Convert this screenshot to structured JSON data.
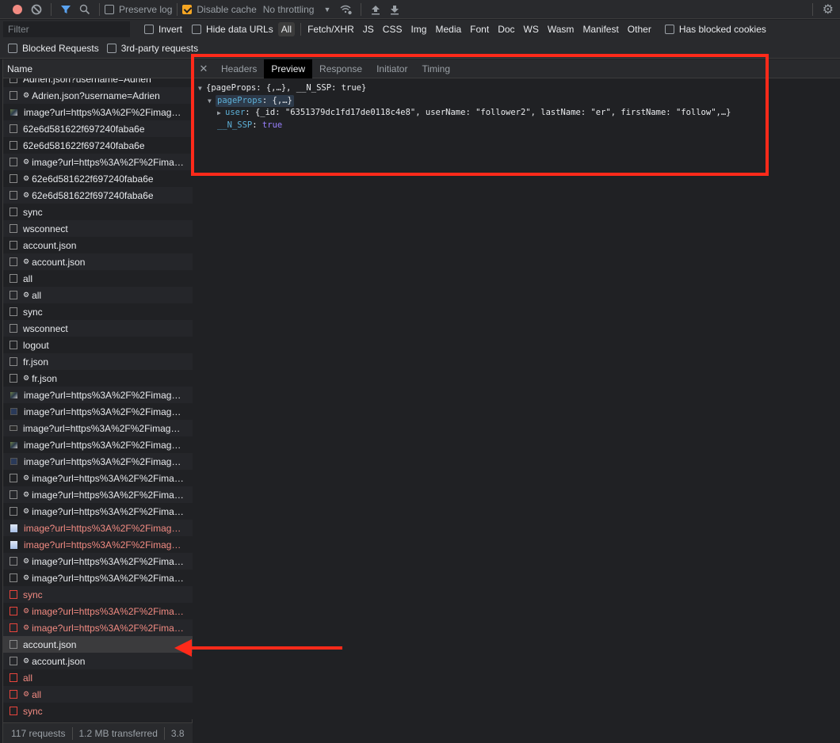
{
  "toolbar": {
    "record_icon": "record-icon",
    "clear_icon": "clear-icon",
    "filter_icon": "filter-icon",
    "search_icon": "search-icon",
    "preserve_log_label": "Preserve log",
    "preserve_log_checked": false,
    "disable_cache_label": "Disable cache",
    "disable_cache_checked": true,
    "throttling_value": "No throttling",
    "network_conditions_icon": "wifi-settings-icon",
    "import_icon": "upload-icon",
    "export_icon": "download-icon",
    "settings_icon": "gear-icon"
  },
  "filter": {
    "placeholder": "Filter",
    "value": "",
    "invert_label": "Invert",
    "hide_data_urls_label": "Hide data URLs",
    "types": [
      "All",
      "Fetch/XHR",
      "JS",
      "CSS",
      "Img",
      "Media",
      "Font",
      "Doc",
      "WS",
      "Wasm",
      "Manifest",
      "Other"
    ],
    "active_type": "All",
    "has_blocked_cookies_label": "Has blocked cookies",
    "blocked_requests_label": "Blocked Requests",
    "third_party_label": "3rd-party requests"
  },
  "requests": {
    "column_header": "Name",
    "items": [
      {
        "name": "Adrien.json?username=Adrien",
        "icon": "doc",
        "gear": false,
        "error": false
      },
      {
        "name": "Adrien.json?username=Adrien",
        "icon": "doc",
        "gear": true,
        "error": false
      },
      {
        "name": "image?url=https%3A%2F%2Fimag…",
        "icon": "img",
        "gear": false,
        "error": false
      },
      {
        "name": "62e6d581622f697240faba6e",
        "icon": "doc",
        "gear": false,
        "error": false
      },
      {
        "name": "62e6d581622f697240faba6e",
        "icon": "doc",
        "gear": false,
        "error": false
      },
      {
        "name": "image?url=https%3A%2F%2Fima…",
        "icon": "doc",
        "gear": true,
        "error": false
      },
      {
        "name": "62e6d581622f697240faba6e",
        "icon": "doc",
        "gear": true,
        "error": false
      },
      {
        "name": "62e6d581622f697240faba6e",
        "icon": "doc",
        "gear": true,
        "error": false
      },
      {
        "name": "sync",
        "icon": "doc",
        "gear": false,
        "error": false
      },
      {
        "name": "wsconnect",
        "icon": "doc",
        "gear": false,
        "error": false
      },
      {
        "name": "account.json",
        "icon": "doc",
        "gear": false,
        "error": false
      },
      {
        "name": "account.json",
        "icon": "doc",
        "gear": true,
        "error": false
      },
      {
        "name": "all",
        "icon": "doc",
        "gear": false,
        "error": false
      },
      {
        "name": "all",
        "icon": "doc",
        "gear": true,
        "error": false
      },
      {
        "name": "sync",
        "icon": "doc",
        "gear": false,
        "error": false
      },
      {
        "name": "wsconnect",
        "icon": "doc",
        "gear": false,
        "error": false
      },
      {
        "name": "logout",
        "icon": "doc",
        "gear": false,
        "error": false
      },
      {
        "name": "fr.json",
        "icon": "doc",
        "gear": false,
        "error": false
      },
      {
        "name": "fr.json",
        "icon": "doc",
        "gear": true,
        "error": false
      },
      {
        "name": "image?url=https%3A%2F%2Fimag…",
        "icon": "img",
        "gear": false,
        "error": false
      },
      {
        "name": "image?url=https%3A%2F%2Fimag…",
        "icon": "img2",
        "gear": false,
        "error": false
      },
      {
        "name": "image?url=https%3A%2F%2Fimag…",
        "icon": "img3",
        "gear": false,
        "error": false
      },
      {
        "name": "image?url=https%3A%2F%2Fimag…",
        "icon": "img",
        "gear": false,
        "error": false
      },
      {
        "name": "image?url=https%3A%2F%2Fimag…",
        "icon": "img2",
        "gear": false,
        "error": false
      },
      {
        "name": "image?url=https%3A%2F%2Fima…",
        "icon": "doc",
        "gear": true,
        "error": false
      },
      {
        "name": "image?url=https%3A%2F%2Fima…",
        "icon": "doc",
        "gear": true,
        "error": false
      },
      {
        "name": "image?url=https%3A%2F%2Fima…",
        "icon": "doc",
        "gear": true,
        "error": false
      },
      {
        "name": "image?url=https%3A%2F%2Fimag…",
        "icon": "imgw",
        "gear": false,
        "error": true
      },
      {
        "name": "image?url=https%3A%2F%2Fimag…",
        "icon": "imgw",
        "gear": false,
        "error": true
      },
      {
        "name": "image?url=https%3A%2F%2Fima…",
        "icon": "doc",
        "gear": true,
        "error": false
      },
      {
        "name": "image?url=https%3A%2F%2Fima…",
        "icon": "doc",
        "gear": true,
        "error": false
      },
      {
        "name": "sync",
        "icon": "doc",
        "gear": false,
        "error": true
      },
      {
        "name": "image?url=https%3A%2F%2Fima…",
        "icon": "doc",
        "gear": true,
        "error": true
      },
      {
        "name": "image?url=https%3A%2F%2Fima…",
        "icon": "doc",
        "gear": true,
        "error": true
      },
      {
        "name": "account.json",
        "icon": "doc",
        "gear": false,
        "error": false,
        "selected": true
      },
      {
        "name": "account.json",
        "icon": "doc",
        "gear": true,
        "error": false
      },
      {
        "name": "all",
        "icon": "doc",
        "gear": false,
        "error": true
      },
      {
        "name": "all",
        "icon": "doc",
        "gear": true,
        "error": true
      },
      {
        "name": "sync",
        "icon": "doc",
        "gear": false,
        "error": true
      }
    ]
  },
  "status": {
    "requests": "117 requests",
    "transferred": "1.2 MB transferred",
    "resources": "3.8"
  },
  "details": {
    "close_icon": "close-icon",
    "tabs": [
      "Headers",
      "Preview",
      "Response",
      "Initiator",
      "Timing"
    ],
    "active_tab": "Preview",
    "preview": {
      "root_summary": "{pageProps: {,…}, __N_SSP: true}",
      "pageProps_key": "pageProps",
      "pageProps_summary": ": {,…}",
      "user_key": "user",
      "user_summary": ": {_id: \"6351379dc1fd17de0118c4e8\", userName: \"follower2\", lastName: \"er\", firstName: \"follow\",…}",
      "nssp_key": "__N_SSP",
      "nssp_value": "true"
    }
  },
  "annotations": {
    "highlight_color": "#ff2a1a"
  }
}
